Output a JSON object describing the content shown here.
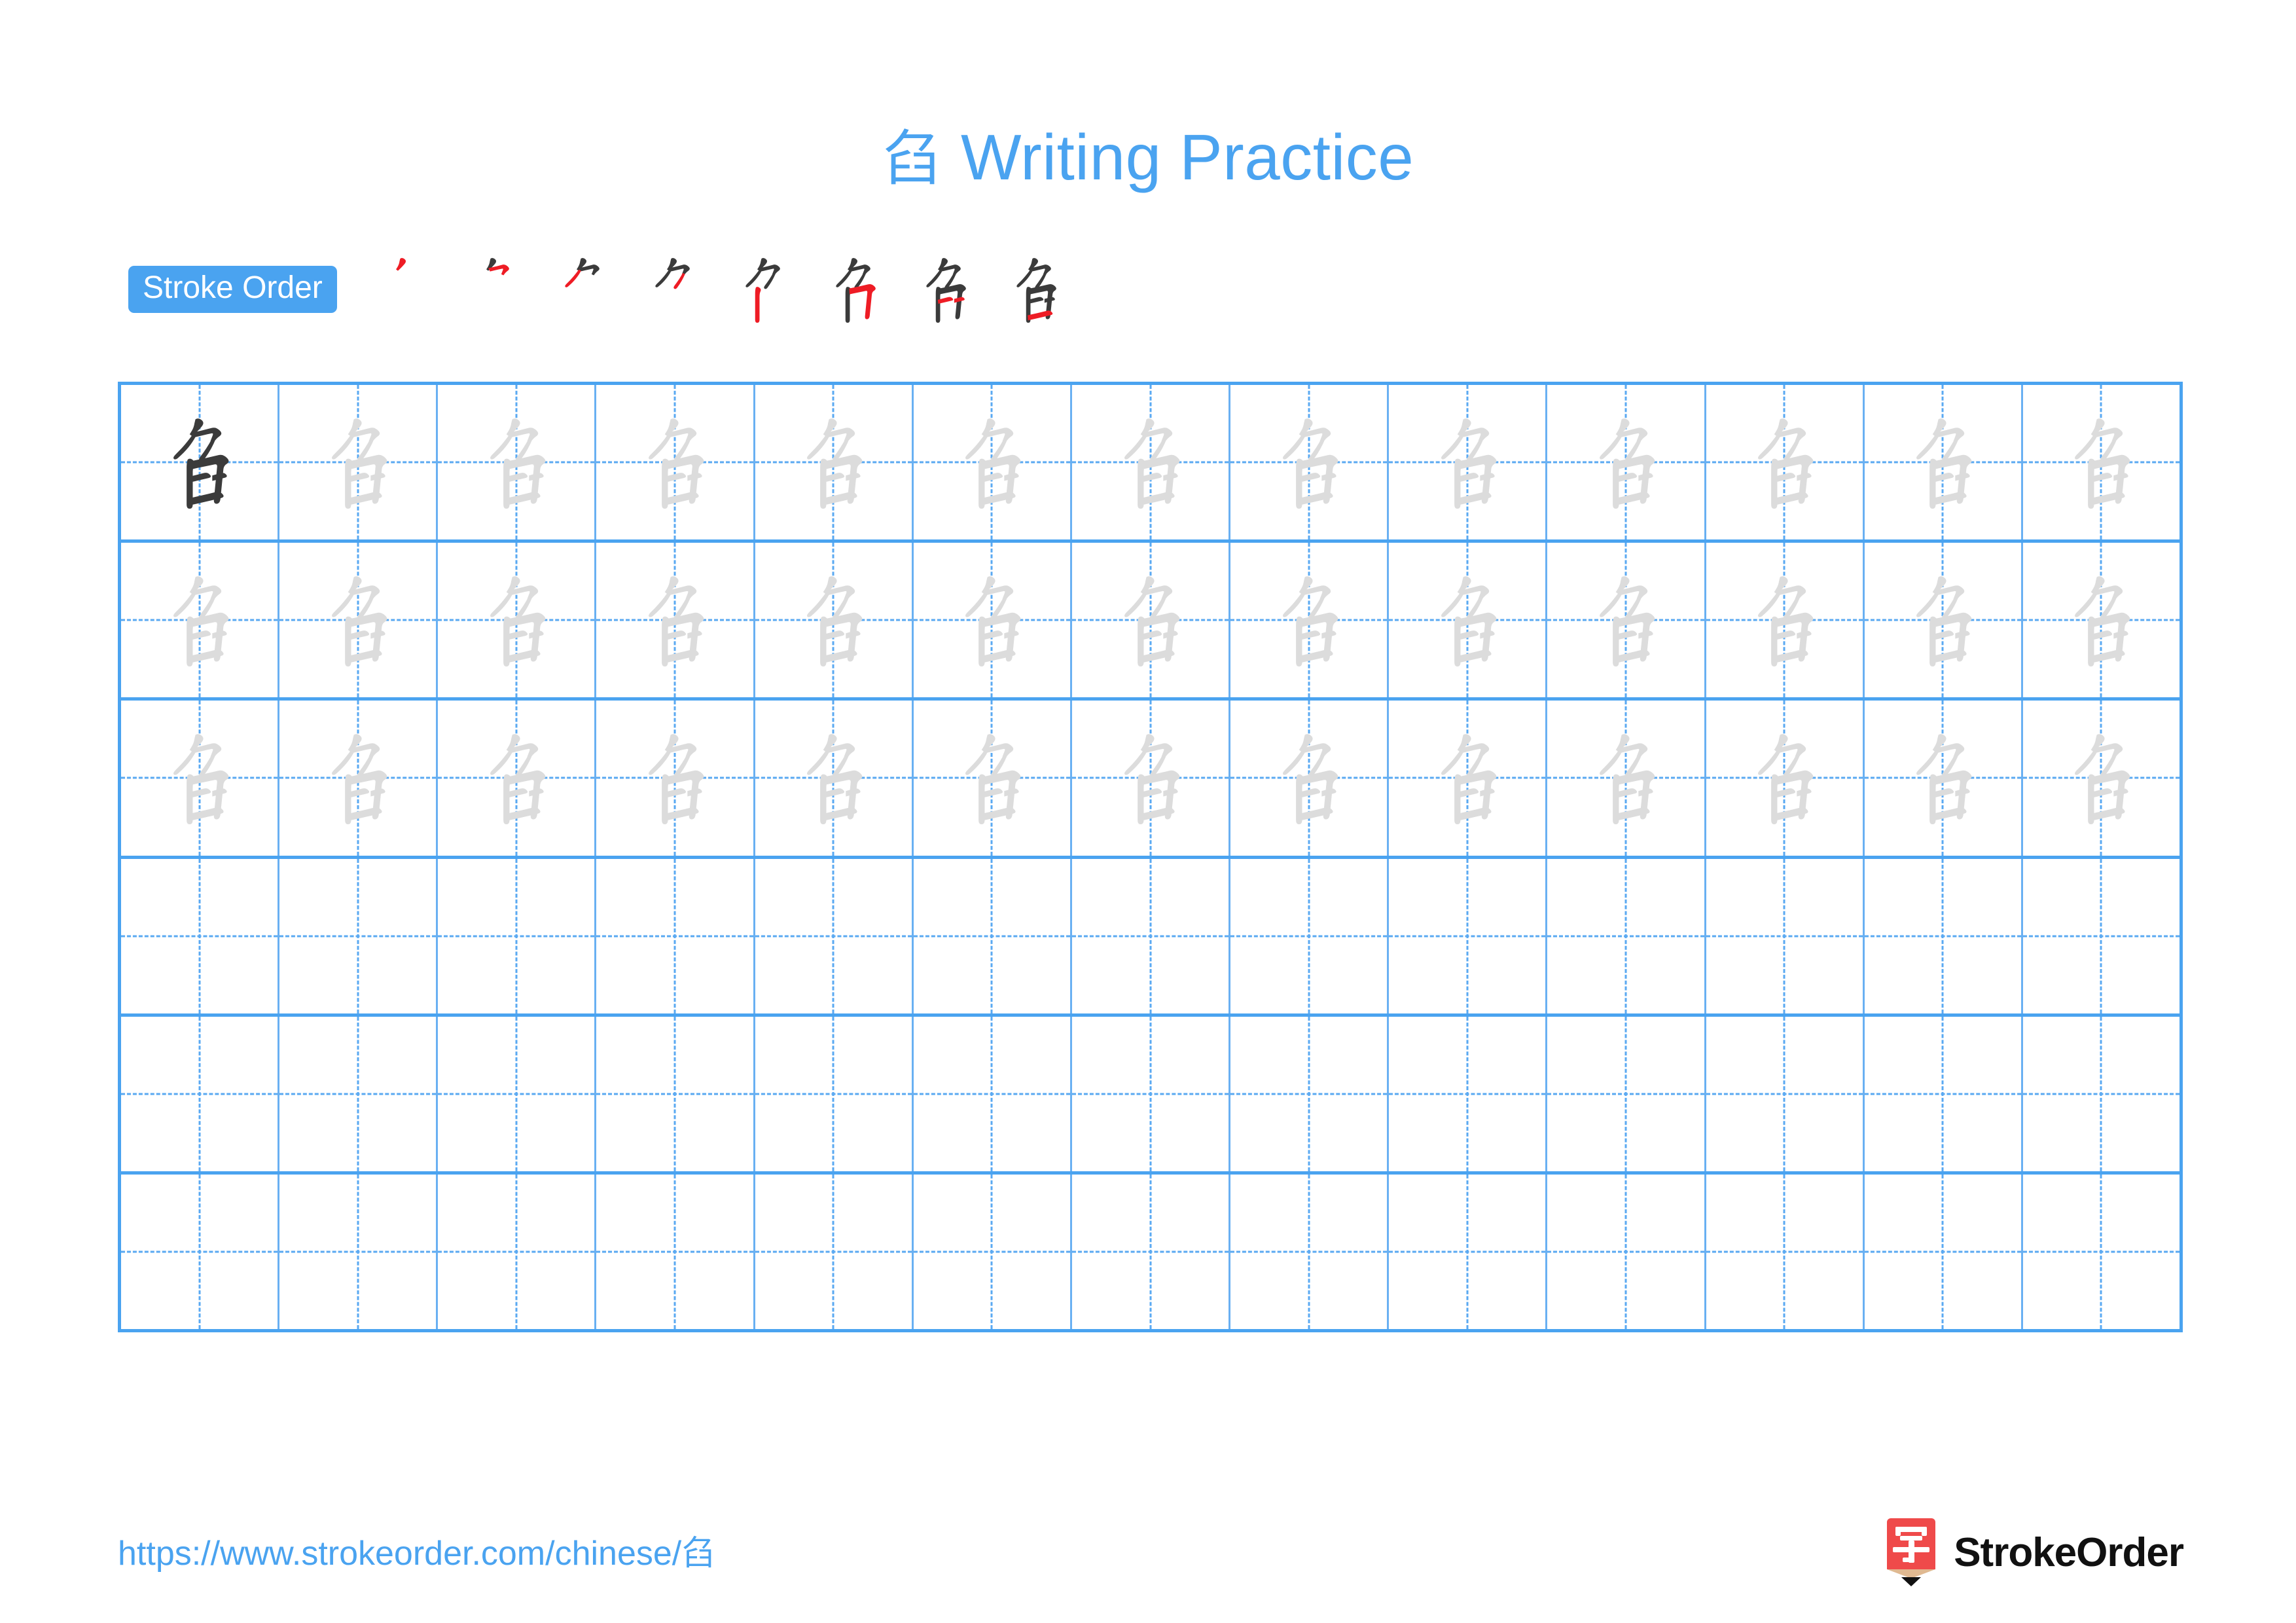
{
  "document": {
    "character": "臽",
    "title_suffix": "Writing Practice",
    "title_full": "臽 Writing Practice"
  },
  "stroke_order": {
    "badge_label": "Stroke Order",
    "stroke_count": 8,
    "steps": [
      {
        "index": 1,
        "strokes_shown": 1,
        "new_stroke_color": "#ee1c25",
        "done_stroke_color": "#3b3b3b"
      },
      {
        "index": 2,
        "strokes_shown": 2,
        "new_stroke_color": "#ee1c25",
        "done_stroke_color": "#3b3b3b"
      },
      {
        "index": 3,
        "strokes_shown": 3,
        "new_stroke_color": "#ee1c25",
        "done_stroke_color": "#3b3b3b"
      },
      {
        "index": 4,
        "strokes_shown": 4,
        "new_stroke_color": "#ee1c25",
        "done_stroke_color": "#3b3b3b"
      },
      {
        "index": 5,
        "strokes_shown": 5,
        "new_stroke_color": "#ee1c25",
        "done_stroke_color": "#3b3b3b"
      },
      {
        "index": 6,
        "strokes_shown": 6,
        "new_stroke_color": "#ee1c25",
        "done_stroke_color": "#3b3b3b"
      },
      {
        "index": 7,
        "strokes_shown": 7,
        "new_stroke_color": "#ee1c25",
        "done_stroke_color": "#3b3b3b"
      },
      {
        "index": 8,
        "strokes_shown": 8,
        "new_stroke_color": "#ee1c25",
        "done_stroke_color": "#3b3b3b"
      }
    ]
  },
  "practice_grid": {
    "columns": 13,
    "rows": 6,
    "cells": [
      [
        "dark",
        "trace",
        "trace",
        "trace",
        "trace",
        "trace",
        "trace",
        "trace",
        "trace",
        "trace",
        "trace",
        "trace",
        "trace"
      ],
      [
        "trace",
        "trace",
        "trace",
        "trace",
        "trace",
        "trace",
        "trace",
        "trace",
        "trace",
        "trace",
        "trace",
        "trace",
        "trace"
      ],
      [
        "trace",
        "trace",
        "trace",
        "trace",
        "trace",
        "trace",
        "trace",
        "trace",
        "trace",
        "trace",
        "trace",
        "trace",
        "trace"
      ],
      [
        "empty",
        "empty",
        "empty",
        "empty",
        "empty",
        "empty",
        "empty",
        "empty",
        "empty",
        "empty",
        "empty",
        "empty",
        "empty"
      ],
      [
        "empty",
        "empty",
        "empty",
        "empty",
        "empty",
        "empty",
        "empty",
        "empty",
        "empty",
        "empty",
        "empty",
        "empty",
        "empty"
      ],
      [
        "empty",
        "empty",
        "empty",
        "empty",
        "empty",
        "empty",
        "empty",
        "empty",
        "empty",
        "empty",
        "empty",
        "empty",
        "empty"
      ]
    ]
  },
  "footer": {
    "url": "https://www.strokeorder.com/chinese/臽",
    "brand_name": "StrokeOrder",
    "brand_mark_character": "字"
  },
  "colors": {
    "accent_blue": "#4aa3f0",
    "grid_line_light": "#69b0f2",
    "guide_dash": "#5aa9f2",
    "ink_dark": "#3b3b3b",
    "ink_trace": "#dcdcdc",
    "stroke_highlight": "#ee1c25",
    "brand_red": "#ef4a4a",
    "brand_tan": "#e0b991",
    "brand_black": "#111111"
  }
}
